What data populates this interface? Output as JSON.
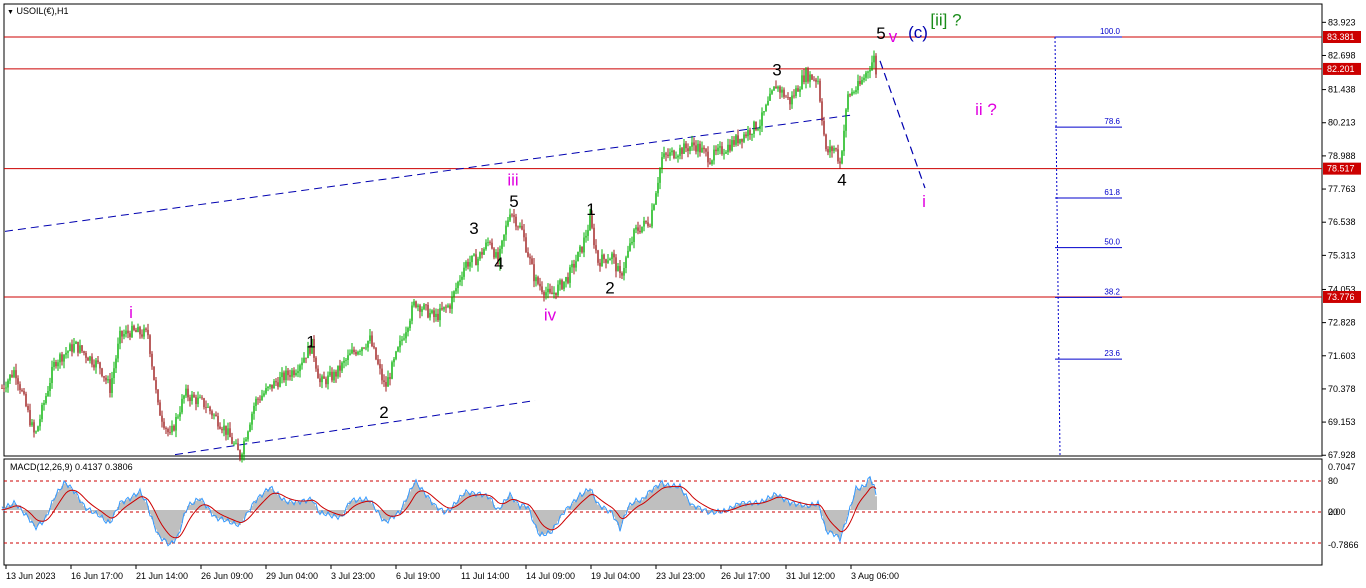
{
  "header": {
    "symbol_label": "USOIL(€),H1",
    "menu_icon": "triangle-down-icon"
  },
  "macd": {
    "label": "MACD(12,26,9) 0.4137 0.3806",
    "ticks": [
      "0.7047",
      "80",
      "0.00",
      "20",
      "-0.7866"
    ]
  },
  "colors": {
    "bull": "#00b000",
    "bear": "#9c1a1a",
    "resistance": "#cc0000",
    "trend": "#0000b0",
    "fib": "#0000cc",
    "magenta": "#e000e0",
    "green": "#1a8c1a",
    "macd_line": "#3399ff",
    "macd_signal": "#cc0000",
    "histogram": "#bfbfbf"
  },
  "chart_data": {
    "type": "candlestick",
    "title": "USOIL(€),H1",
    "ylim": [
      67.9,
      84.6
    ],
    "y_ticks": [
      "83.923",
      "82.698",
      "81.438",
      "80.213",
      "78.988",
      "77.763",
      "76.538",
      "75.313",
      "74.053",
      "72.828",
      "71.603",
      "70.378",
      "69.153",
      "67.928"
    ],
    "x_ticks": [
      "13 Jun 2023",
      "16 Jun 17:00",
      "21 Jun 14:00",
      "26 Jun 09:00",
      "29 Jun 04:00",
      "3 Jul 23:00",
      "6 Jul 19:00",
      "11 Jul 14:00",
      "14 Jul 09:00",
      "19 Jul 04:00",
      "23 Jul 23:00",
      "26 Jul 17:00",
      "31 Jul 12:00",
      "3 Aug 06:00"
    ],
    "price_path": [
      [
        0,
        70.3
      ],
      [
        15,
        71.1
      ],
      [
        35,
        68.6
      ],
      [
        55,
        71.4
      ],
      [
        75,
        72.0
      ],
      [
        100,
        71.2
      ],
      [
        110,
        70.4
      ],
      [
        120,
        72.3
      ],
      [
        130,
        72.5
      ],
      [
        148,
        72.4
      ],
      [
        158,
        69.7
      ],
      [
        170,
        68.6
      ],
      [
        185,
        70.2
      ],
      [
        205,
        69.8
      ],
      [
        225,
        68.9
      ],
      [
        240,
        67.9
      ],
      [
        255,
        69.9
      ],
      [
        275,
        70.6
      ],
      [
        295,
        71.1
      ],
      [
        312,
        72.0
      ],
      [
        320,
        70.6
      ],
      [
        335,
        70.9
      ],
      [
        352,
        71.7
      ],
      [
        370,
        72.2
      ],
      [
        385,
        70.4
      ],
      [
        400,
        72.0
      ],
      [
        415,
        73.6
      ],
      [
        435,
        73.0
      ],
      [
        450,
        73.5
      ],
      [
        465,
        75.0
      ],
      [
        478,
        75.2
      ],
      [
        490,
        75.9
      ],
      [
        498,
        75.0
      ],
      [
        510,
        77.0
      ],
      [
        522,
        76.2
      ],
      [
        535,
        74.4
      ],
      [
        550,
        73.8
      ],
      [
        568,
        74.5
      ],
      [
        582,
        75.6
      ],
      [
        590,
        76.6
      ],
      [
        598,
        75.1
      ],
      [
        612,
        75.3
      ],
      [
        620,
        74.5
      ],
      [
        635,
        76.2
      ],
      [
        650,
        76.6
      ],
      [
        662,
        78.9
      ],
      [
        680,
        79.2
      ],
      [
        695,
        79.4
      ],
      [
        710,
        78.9
      ],
      [
        730,
        79.4
      ],
      [
        760,
        80.2
      ],
      [
        776,
        81.6
      ],
      [
        790,
        81.0
      ],
      [
        805,
        82.0
      ],
      [
        818,
        81.8
      ],
      [
        826,
        79.1
      ],
      [
        835,
        79.3
      ],
      [
        840,
        78.7
      ],
      [
        848,
        81.2
      ],
      [
        860,
        81.6
      ],
      [
        868,
        82.2
      ],
      [
        874,
        82.6
      ],
      [
        876,
        82.1
      ]
    ],
    "price_axis_labels": [
      {
        "value": 83.381,
        "text": "83.381",
        "color": "#cc0000"
      },
      {
        "value": 82.201,
        "text": "82.201",
        "color": "#cc0000"
      },
      {
        "value": 78.517,
        "text": "78.517",
        "color": "#cc0000"
      },
      {
        "value": 73.776,
        "text": "73.776",
        "color": "#cc0000"
      }
    ],
    "horizontal_levels": [
      83.381,
      82.201,
      78.517,
      73.776
    ],
    "fib_levels": [
      {
        "label": "100.0",
        "value": 83.381
      },
      {
        "label": "78.6",
        "value": 80.05
      },
      {
        "label": "61.8",
        "value": 77.43
      },
      {
        "label": "50.0",
        "value": 75.6
      },
      {
        "label": "38.2",
        "value": 73.76
      },
      {
        "label": "23.6",
        "value": 71.48
      }
    ],
    "trendlines": [
      {
        "x1": 5,
        "y1": 76.2,
        "x2": 852,
        "y2": 80.5
      },
      {
        "x1": 175,
        "y1": 67.95,
        "x2": 535,
        "y2": 69.95
      }
    ],
    "projection": [
      {
        "x": 880,
        "y": 82.5
      },
      {
        "x": 925,
        "y": 77.8
      }
    ],
    "wave_labels": [
      {
        "text": "i",
        "x": 131,
        "y": 73.0,
        "color": "#e000e0"
      },
      {
        "text": "1",
        "x": 311,
        "y": 71.9,
        "color": "#000000"
      },
      {
        "text": "2",
        "x": 384,
        "y": 69.3,
        "color": "#000000"
      },
      {
        "text": "3",
        "x": 474,
        "y": 76.1,
        "color": "#000000"
      },
      {
        "text": "4",
        "x": 499,
        "y": 74.8,
        "color": "#000000"
      },
      {
        "text": "iii",
        "x": 513,
        "y": 77.9,
        "color": "#e000e0"
      },
      {
        "text": "5",
        "x": 514,
        "y": 77.1,
        "color": "#000000"
      },
      {
        "text": "iv",
        "x": 550,
        "y": 72.9,
        "color": "#e000e0"
      },
      {
        "text": "1",
        "x": 591,
        "y": 76.8,
        "color": "#000000"
      },
      {
        "text": "2",
        "x": 610,
        "y": 73.9,
        "color": "#000000"
      },
      {
        "text": "3",
        "x": 777,
        "y": 81.95,
        "color": "#000000"
      },
      {
        "text": "4",
        "x": 842,
        "y": 77.9,
        "color": "#000000"
      },
      {
        "text": "5",
        "x": 881,
        "y": 83.3,
        "color": "#000000"
      },
      {
        "text": "v",
        "x": 893,
        "y": 83.2,
        "color": "#e000e0"
      },
      {
        "text": "(c)",
        "x": 918,
        "y": 83.35,
        "color": "#0000b0"
      },
      {
        "text": "[ii] ?",
        "x": 946,
        "y": 83.8,
        "color": "#1a8c1a"
      },
      {
        "text": "ii ?",
        "x": 986,
        "y": 80.5,
        "color": "#e000e0"
      },
      {
        "text": "i",
        "x": 924,
        "y": 77.1,
        "color": "#e000e0"
      }
    ]
  }
}
